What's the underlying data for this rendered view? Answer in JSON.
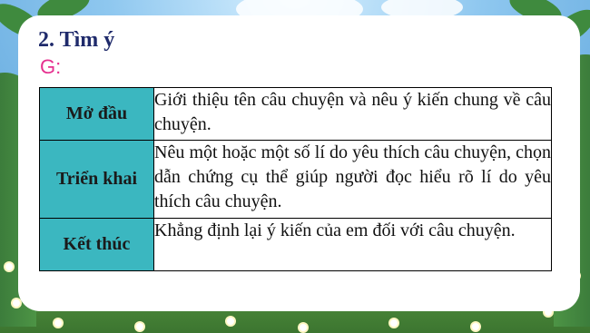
{
  "slide": {
    "title": "2. Tìm ý",
    "subtitle": "G:"
  },
  "outline": {
    "rows": [
      {
        "section": "Mở đầu",
        "content": "Giới thiệu tên câu chuyện và nêu ý kiến chung về câu chuyện."
      },
      {
        "section": "Triển khai",
        "content": "Nêu một hoặc một số lí do yêu thích câu chuyện, chọn dẫn chứng cụ thể giúp người đọc hiểu rõ lí do yêu thích câu chuyện."
      },
      {
        "section": "Kết thúc",
        "content": "Khẳng định lại ý kiến của em đối với câu chuyện."
      }
    ]
  },
  "colors": {
    "title": "#1f2a6b",
    "subtitle": "#e6308f",
    "header_cell": "#3bb7c0"
  }
}
